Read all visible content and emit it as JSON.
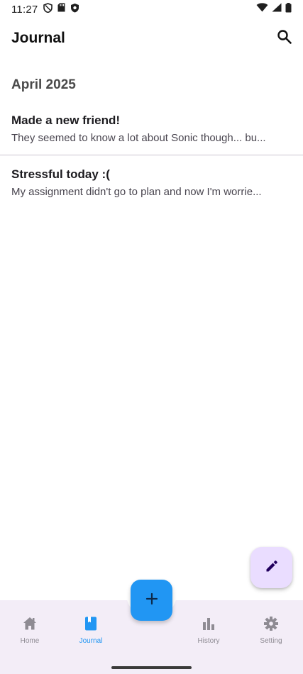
{
  "status_bar": {
    "time": "11:27",
    "left_icons": [
      "shield-icon",
      "sd-card-icon",
      "play-protect-icon"
    ],
    "right_icons": [
      "wifi-icon",
      "signal-icon",
      "battery-icon"
    ]
  },
  "app_bar": {
    "title": "Journal",
    "search_icon": "search-icon"
  },
  "journal": {
    "month": "April 2025",
    "entries": [
      {
        "title": "Made a new friend!",
        "snippet": "They seemed to know a lot about Sonic though... bu..."
      },
      {
        "title": "Stressful today :(",
        "snippet": "My assignment didn't go to plan and now I'm worrie..."
      }
    ]
  },
  "fab": {
    "edit_icon": "pencil-icon",
    "add_icon": "plus-icon"
  },
  "bottom_nav": {
    "items": [
      {
        "label": "Home",
        "icon": "home-icon",
        "active": false
      },
      {
        "label": "Journal",
        "icon": "book-icon",
        "active": true
      },
      {
        "label": "History",
        "icon": "bar-chart-icon",
        "active": false
      },
      {
        "label": "Setting",
        "icon": "gear-icon",
        "active": false
      }
    ]
  },
  "colors": {
    "accent": "#2196f3",
    "nav_background": "#f3edf7",
    "edit_fab_background": "#eaddff",
    "inactive": "#8e8b93"
  }
}
